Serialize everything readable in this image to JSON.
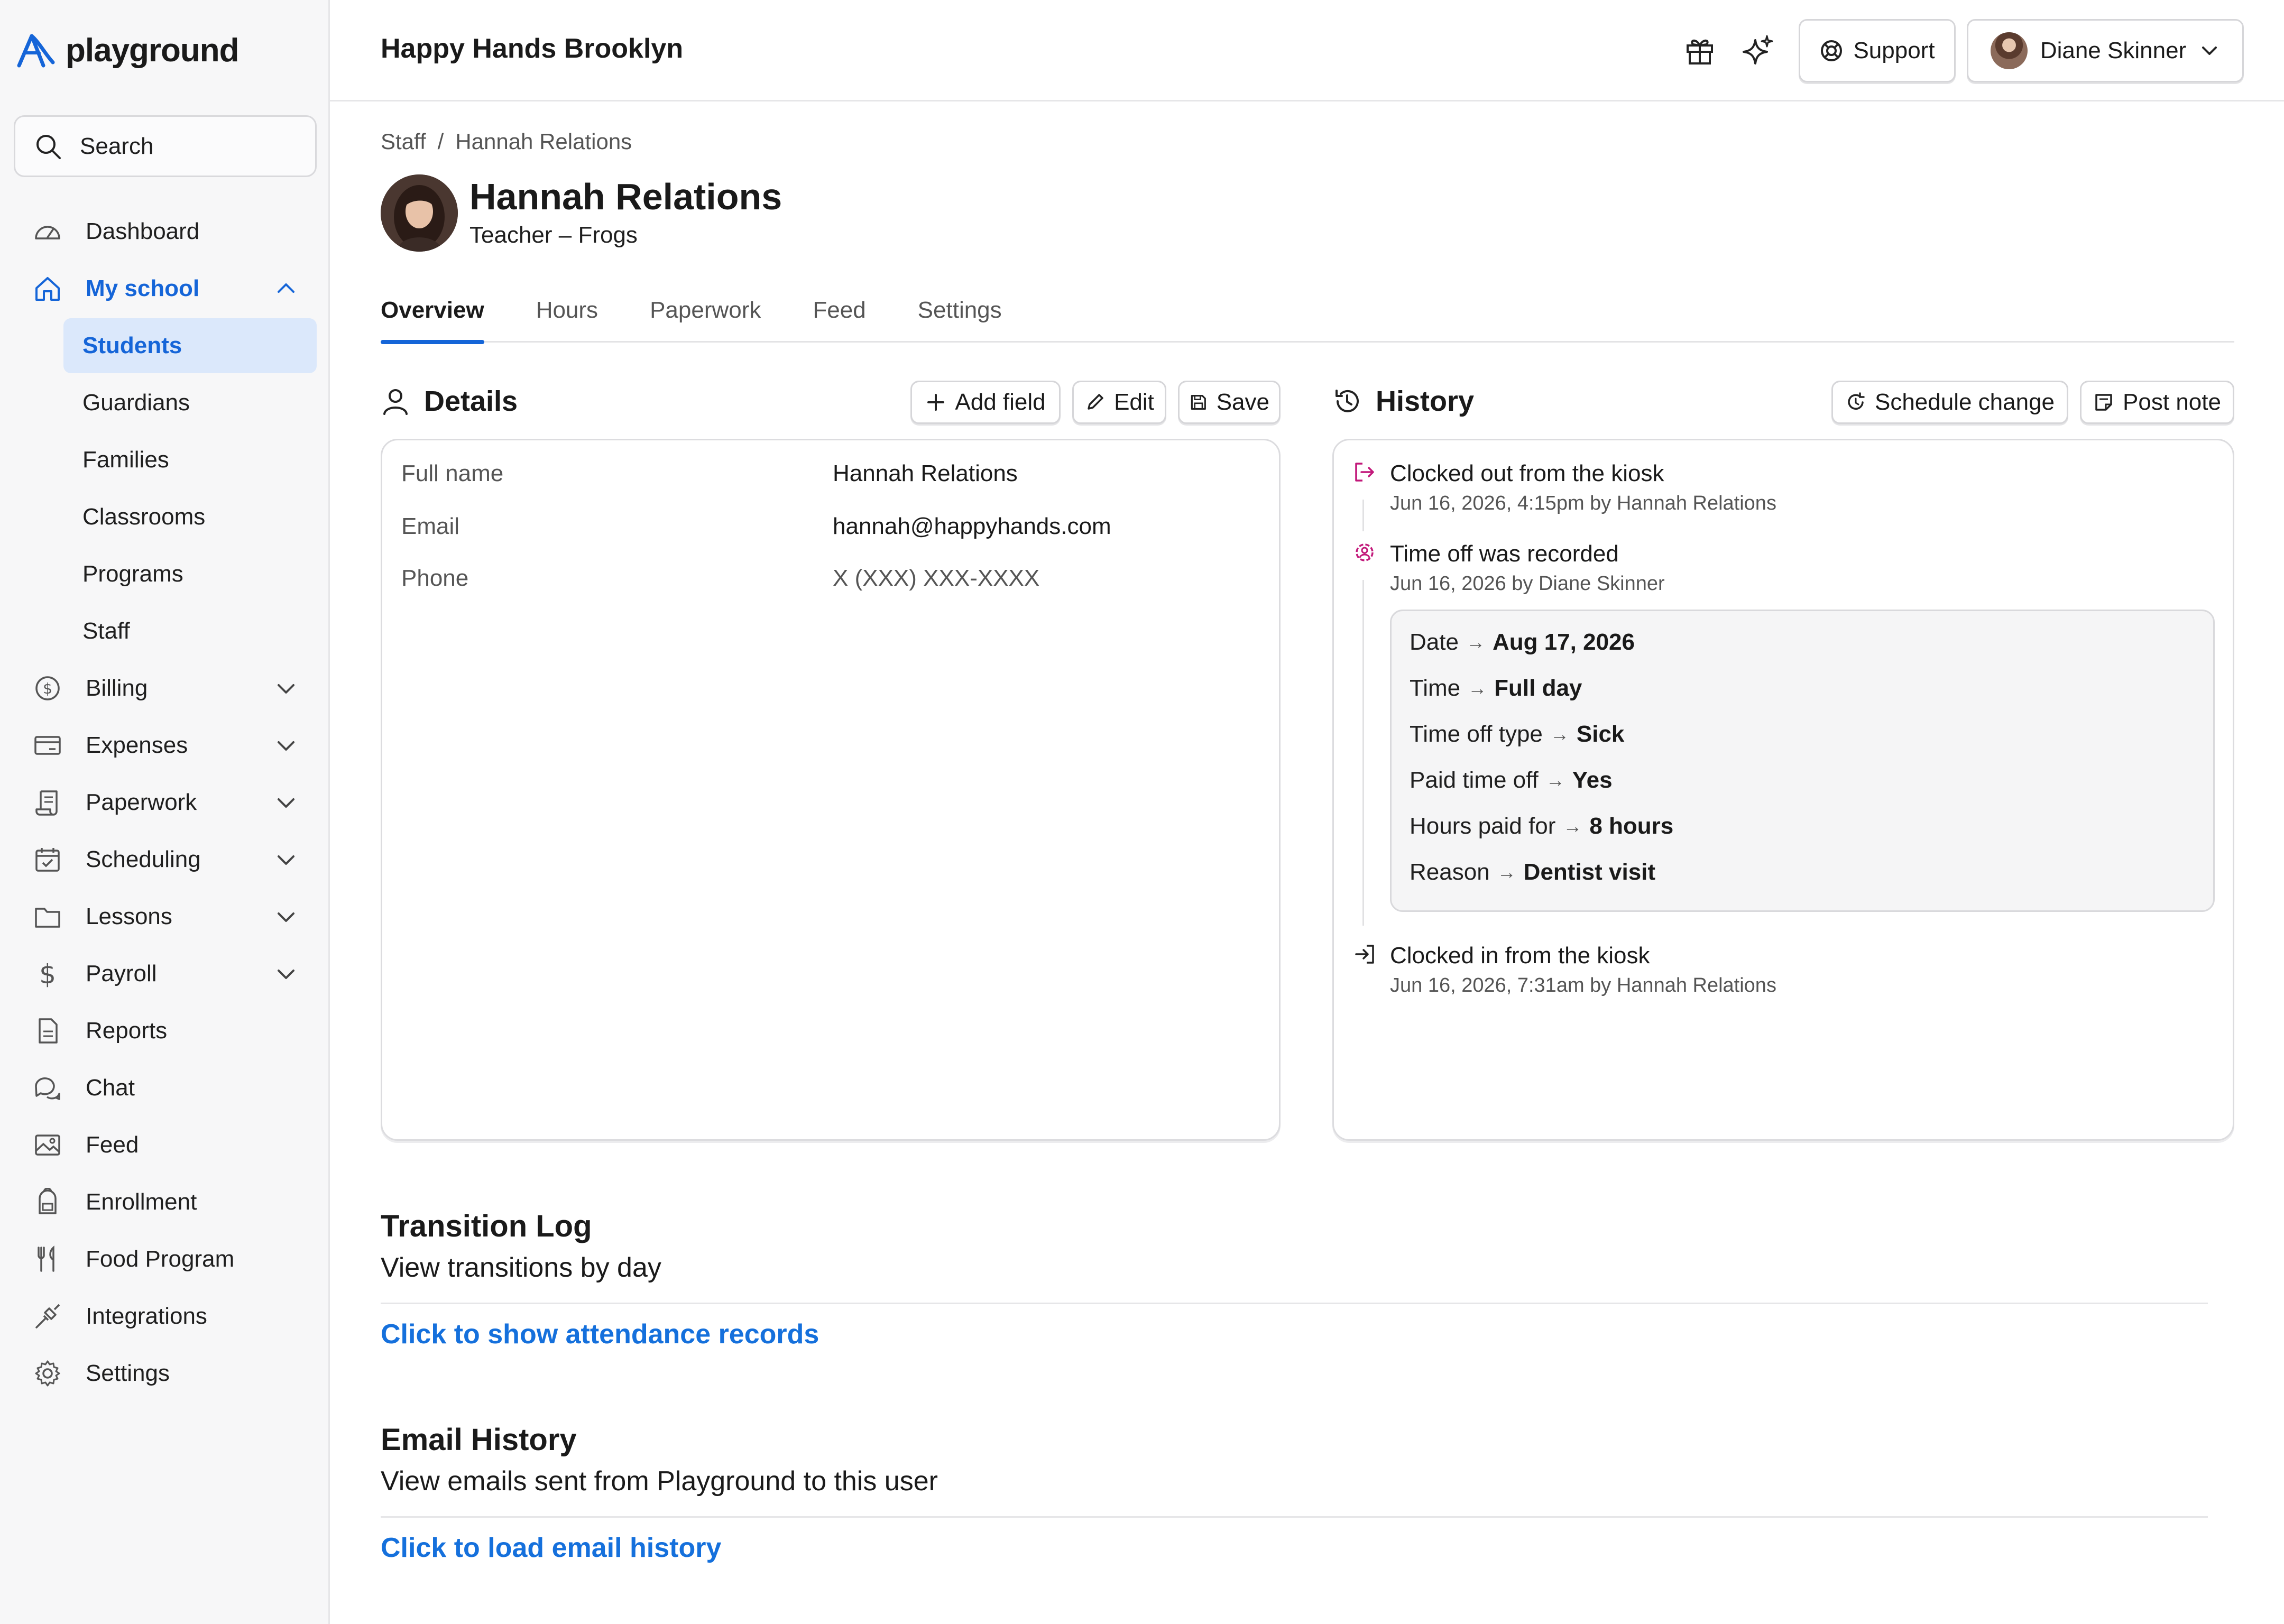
{
  "app": {
    "name": "playground"
  },
  "sidebar": {
    "search_label": "Search",
    "items": [
      {
        "label": "Dashboard",
        "icon": "speedometer-icon"
      },
      {
        "label": "My school",
        "icon": "home-icon"
      },
      {
        "label": "Billing",
        "icon": "dollar-circle-icon"
      },
      {
        "label": "Expenses",
        "icon": "credit-card-icon"
      },
      {
        "label": "Paperwork",
        "icon": "scroll-icon"
      },
      {
        "label": "Scheduling",
        "icon": "calendar-check-icon"
      },
      {
        "label": "Lessons",
        "icon": "folder-icon"
      },
      {
        "label": "Payroll",
        "icon": "dollar-icon"
      },
      {
        "label": "Reports",
        "icon": "report-icon"
      },
      {
        "label": "Chat",
        "icon": "chat-icon"
      },
      {
        "label": "Feed",
        "icon": "image-icon"
      },
      {
        "label": "Enrollment",
        "icon": "backpack-icon"
      },
      {
        "label": "Food Program",
        "icon": "utensils-icon"
      },
      {
        "label": "Integrations",
        "icon": "plug-icon"
      },
      {
        "label": "Settings",
        "icon": "gear-icon"
      }
    ],
    "my_school_sub": [
      "Students",
      "Guardians",
      "Families",
      "Classrooms",
      "Programs",
      "Staff"
    ]
  },
  "header": {
    "org_name": "Happy Hands Brooklyn",
    "support_label": "Support",
    "user_name": "Diane Skinner"
  },
  "breadcrumb": {
    "parent": "Staff",
    "separator": "/",
    "current": "Hannah Relations"
  },
  "profile": {
    "name": "Hannah Relations",
    "role": "Teacher – Frogs"
  },
  "tabs": [
    "Overview",
    "Hours",
    "Paperwork",
    "Feed",
    "Settings"
  ],
  "details": {
    "title": "Details",
    "add_field_label": "Add field",
    "edit_label": "Edit",
    "save_label": "Save",
    "rows": [
      {
        "label": "Full name",
        "value": "Hannah Relations"
      },
      {
        "label": "Email",
        "value": "hannah@happyhands.com"
      },
      {
        "label": "Phone",
        "value": "X (XXX) XXX-XXXX"
      }
    ]
  },
  "history": {
    "title": "History",
    "schedule_change_label": "Schedule change",
    "post_note_label": "Post note",
    "events": [
      {
        "title": "Clocked out from the kiosk",
        "meta": "Jun 16, 2026, 4:15pm by Hannah Relations"
      },
      {
        "title": "Time off was recorded",
        "meta": "Jun 16, 2026 by Diane Skinner"
      },
      {
        "title": "Clocked in from the kiosk",
        "meta": "Jun 16, 2026, 7:31am by Hannah Relations"
      }
    ],
    "changes": [
      {
        "field": "Date",
        "value": "Aug 17, 2026"
      },
      {
        "field": "Time",
        "value": "Full day"
      },
      {
        "field": "Time off type",
        "value": "Sick"
      },
      {
        "field": "Paid time off",
        "value": "Yes"
      },
      {
        "field": "Hours paid for",
        "value": "8 hours"
      },
      {
        "field": "Reason",
        "value": "Dentist visit"
      }
    ]
  },
  "transition_log": {
    "title": "Transition Log",
    "subtitle": "View transitions by day",
    "link": "Click to show attendance records"
  },
  "email_history": {
    "title": "Email History",
    "subtitle": "View emails sent from Playground to this user",
    "link": "Click to load email history"
  },
  "colors": {
    "accent": "#1565d8",
    "selected_bg": "#dbe8fb",
    "magenta": "#c2187a"
  }
}
